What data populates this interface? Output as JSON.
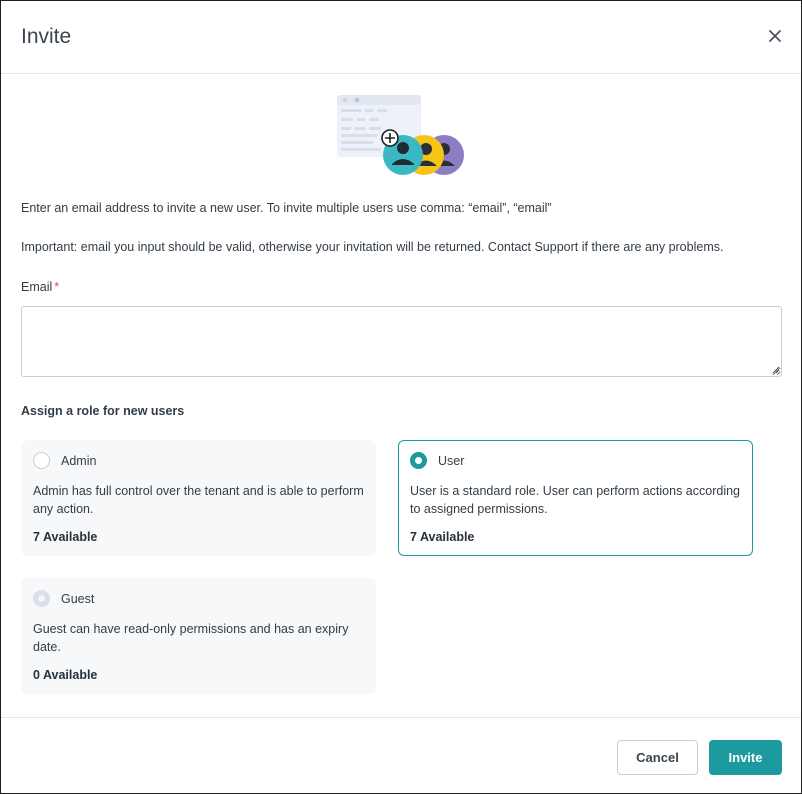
{
  "dialog": {
    "title": "Invite",
    "close_icon": "close-icon"
  },
  "intro_text": "Enter an email address to invite a new user. To invite multiple users use comma: “email”, “email”",
  "important_text": "Important: email you input should be valid, otherwise your invitation will be returned. Contact Support if there are any problems.",
  "email": {
    "label": "Email",
    "required_mark": "*",
    "value": "",
    "placeholder": ""
  },
  "roles": {
    "title": "Assign a role for new users",
    "items": [
      {
        "name": "Admin",
        "description": "Admin has full control over the tenant and is able to perform any action.",
        "available": "7 Available",
        "state": "unselected"
      },
      {
        "name": "User",
        "description": "User is a standard role. User can perform actions according to assigned permissions.",
        "available": "7 Available",
        "state": "selected"
      },
      {
        "name": "Guest",
        "description": "Guest can have read-only permissions and has an expiry date.",
        "available": "0 Available",
        "state": "disabled"
      }
    ]
  },
  "footer": {
    "cancel_label": "Cancel",
    "invite_label": "Invite"
  },
  "colors": {
    "accent": "#1d9aa0",
    "required": "#e0534a",
    "avatar_teal": "#3bb8c3",
    "avatar_yellow": "#f5c518",
    "avatar_purple": "#8c7cc4"
  }
}
